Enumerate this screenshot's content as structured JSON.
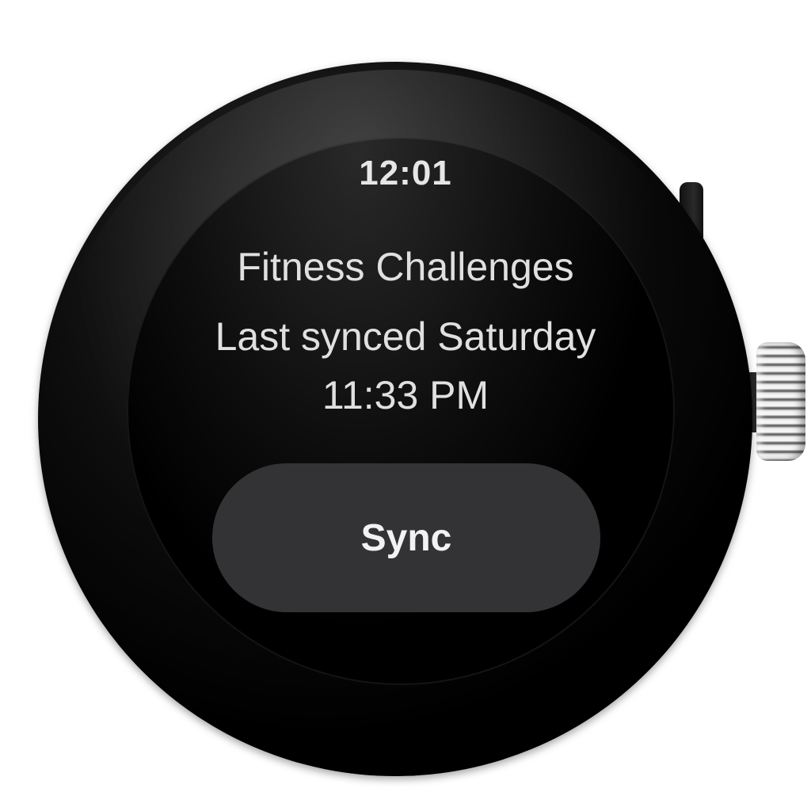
{
  "status_bar": {
    "time": "12:01"
  },
  "sync_screen": {
    "title": "Fitness Challenges",
    "subtitle": "Last synced Saturday 11:33 PM",
    "sync_button_label": "Sync"
  },
  "colors": {
    "screen_background": "#000000",
    "button_background": "#333335",
    "text": "#e0e0e0"
  },
  "icons": {
    "crown": "crown-icon"
  }
}
